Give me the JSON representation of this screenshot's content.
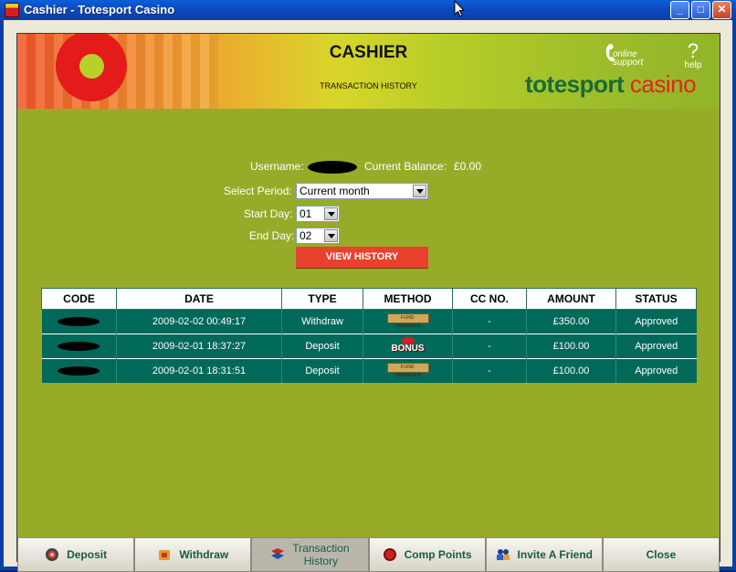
{
  "window": {
    "title": "Cashier - Totesport Casino",
    "minimize_label": "_",
    "maximize_label": "□",
    "close_label": "✕"
  },
  "header": {
    "title": "CASHIER",
    "subtitle": "TRANSACTION HISTORY",
    "support_label": "online support",
    "help_symbol": "?",
    "help_label": "help",
    "brand_part1": "totesport",
    "brand_part2": "casino"
  },
  "form": {
    "username_label": "Username:",
    "balance_label": "Current Balance:",
    "balance_value": "£0.00",
    "period_label": "Select Period:",
    "period_value": "Current month",
    "start_label": "Start Day:",
    "start_value": "01",
    "end_label": "End Day:",
    "end_value": "02",
    "view_button": "VIEW HISTORY"
  },
  "table": {
    "columns": [
      "CODE",
      "DATE",
      "TYPE",
      "METHOD",
      "CC NO.",
      "AMOUNT",
      "STATUS"
    ],
    "rows": [
      {
        "date": "2009-02-02 00:49:17",
        "type": "Withdraw",
        "method": "fund-transfer",
        "cc": "-",
        "amount": "£350.00",
        "status": "Approved"
      },
      {
        "date": "2009-02-01 18:37:27",
        "type": "Deposit",
        "method": "bonus",
        "cc": "-",
        "amount": "£100.00",
        "status": "Approved"
      },
      {
        "date": "2009-02-01 18:31:51",
        "type": "Deposit",
        "method": "fund-transfer",
        "cc": "-",
        "amount": "£100.00",
        "status": "Approved"
      }
    ],
    "fund_transfer_text": "FUND TRANSFER",
    "bonus_text": "BONUS"
  },
  "tabs": [
    {
      "label": "Deposit",
      "icon": "deposit-icon"
    },
    {
      "label": "Withdraw",
      "icon": "withdraw-icon"
    },
    {
      "label": "Transaction",
      "label2": "History",
      "icon": "transaction-history-icon",
      "active": true
    },
    {
      "label": "Comp Points",
      "icon": "comp-points-icon"
    },
    {
      "label": "Invite A Friend",
      "icon": "invite-friend-icon"
    },
    {
      "label": "Close"
    }
  ],
  "colors": {
    "panel": "#98ab29",
    "table_row": "#00695a",
    "view_button": "#e8422e",
    "brand_green": "#1a6b34",
    "brand_red": "#e2261d"
  }
}
